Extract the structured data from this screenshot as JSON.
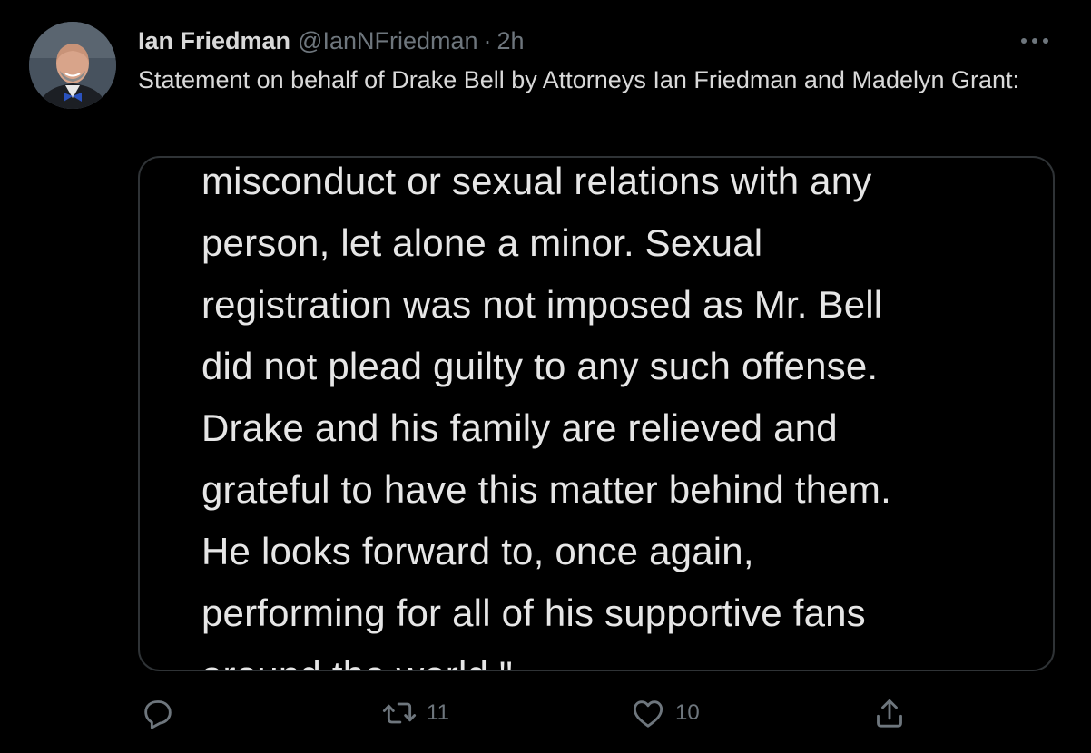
{
  "tweet": {
    "author_name": "Ian Friedman",
    "author_handle": "@IanNFriedman",
    "separator": "·",
    "time": "2h",
    "text": "Statement on behalf of Drake Bell by Attorneys Ian Friedman and Madelyn Grant:",
    "media_lines": [
      "misconduct or sexual relations with any",
      "person, let alone a minor. Sexual",
      "registration was not imposed as Mr. Bell",
      "did not plead guilty to any such offense.",
      "Drake and his family are relieved and",
      "grateful to have this matter behind them.",
      "He looks forward to, once again,",
      "performing for all of his supportive fans",
      "around the world.\""
    ]
  },
  "actions": {
    "reply_icon": "reply-icon",
    "retweet_icon": "retweet-icon",
    "retweet_count": "11",
    "like_icon": "heart-icon",
    "like_count": "10",
    "share_icon": "share-icon"
  },
  "colors": {
    "background": "#000000",
    "text": "#d9d9d9",
    "secondary": "#6e767d",
    "border": "#2f3336"
  }
}
